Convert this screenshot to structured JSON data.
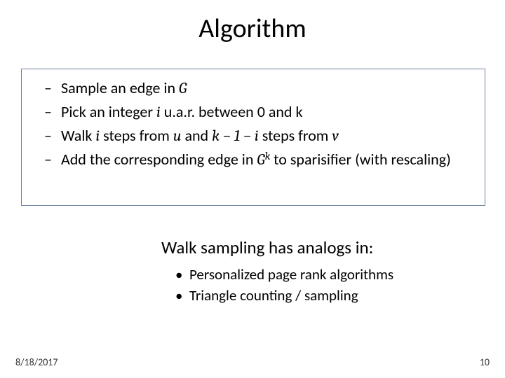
{
  "title": "Algorithm",
  "steps": {
    "s1_a": "Sample an edge in ",
    "s1_G": "G",
    "s2_a": "Pick an integer ",
    "s2_i": "i",
    "s2_b": " u.a.r. between 0 and k",
    "s3_a": "Walk ",
    "s3_i": "i",
    "s3_b": " steps from ",
    "s3_u": "u",
    "s3_c": " and ",
    "s3_expr": "k − 1 − i",
    "s3_d": " steps from ",
    "s3_v": "v",
    "s4_a": "Add the corresponding edge in ",
    "s4_G": "G",
    "s4_k": "k",
    "s4_b": " to sparisifier (with rescaling)"
  },
  "analogs": {
    "heading": "Walk sampling has analogs in:",
    "items": [
      "Personalized page rank algorithms",
      "Triangle counting / sampling"
    ]
  },
  "footer": {
    "date": "8/18/2017",
    "page": "10"
  }
}
